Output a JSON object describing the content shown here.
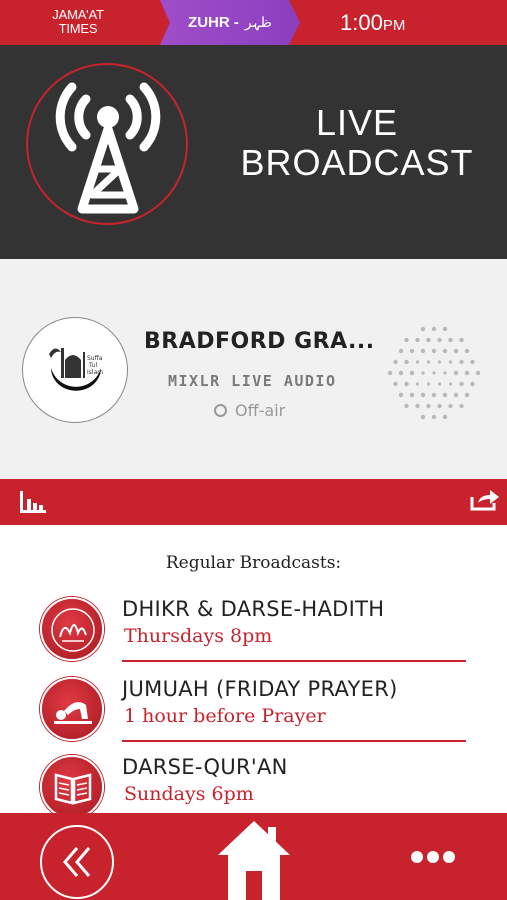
{
  "topbar": {
    "brand_line1": "JAMA'AT",
    "brand_line2": "TIMES",
    "prayer_name": "ZUHR -",
    "prayer_name_arabic": "ظہر",
    "time": "1:00",
    "time_suffix": "PM",
    "accent_color": "#c8222c",
    "pill_color": "#9b47c6"
  },
  "hero": {
    "title_line1": "LIVE",
    "title_line2": "BROADCAST",
    "icon": "broadcast-tower-icon"
  },
  "player": {
    "station_name": "BRADFORD GRA...",
    "subtitle": "MIXLR LIVE AUDIO",
    "status": "Off-air",
    "logo_icon": "station-logo-icon",
    "logo_text": "Suffa Tul Islam"
  },
  "toolbar": {
    "stats_icon": "bar-chart-icon",
    "share_icon": "share-icon"
  },
  "broadcasts": {
    "title": "Regular Broadcasts:",
    "items": [
      {
        "name": "DHIKR & DARSE-HADITH",
        "time": "Thursdays 8pm",
        "icon": "calligraphy-icon"
      },
      {
        "name": "JUMUAH (FRIDAY PRAYER)",
        "time": "1 hour before Prayer",
        "icon": "prostration-icon"
      },
      {
        "name": "DARSE-QUR'AN",
        "time": "Sundays 6pm",
        "icon": "book-icon"
      }
    ]
  },
  "bottombar": {
    "back_icon": "double-chevron-left-icon",
    "home_icon": "home-icon",
    "more_icon": "more-dots-icon"
  }
}
